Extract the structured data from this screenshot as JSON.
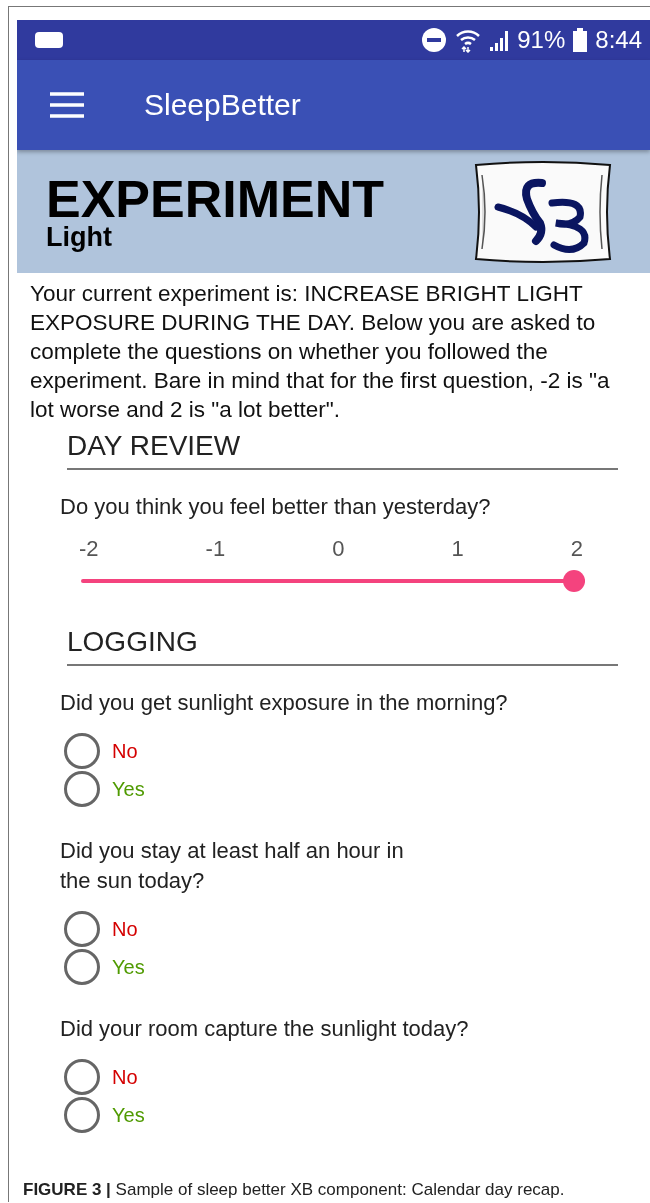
{
  "status_bar": {
    "battery": "91%",
    "time": "8:44"
  },
  "app_bar": {
    "title": "SleepBetter"
  },
  "header": {
    "title": "EXPERIMENT",
    "subtitle": "Light"
  },
  "intro": "Your current experiment is: INCREASE BRIGHT LIGHT EXPOSURE DURING THE DAY. Below you are asked to complete the questions on whether you followed the experiment. Bare in mind that for the first question, -2 is \"a lot worse and 2 is \"a lot better\".",
  "sections": [
    {
      "heading": "DAY REVIEW",
      "items": [
        {
          "kind": "slider",
          "question": "Do you think you feel better than yesterday?",
          "ticks": [
            "-2",
            "-1",
            "0",
            "1",
            "2"
          ],
          "level": 1
        }
      ]
    },
    {
      "heading": "LOGGING",
      "items": [
        {
          "kind": "radio",
          "question": "Did you get sunlight exposure in the morning?",
          "options": [
            {
              "label": "No",
              "selected": false,
              "color": "#d40000"
            },
            {
              "label": "Yes",
              "selected": false,
              "color": "#4f9a00"
            }
          ]
        },
        {
          "kind": "radio",
          "question": "Did you stay at least half an hour in\nthe sun today?",
          "options": [
            {
              "label": "No",
              "selected": false,
              "color": "#d40000"
            },
            {
              "label": "Yes",
              "selected": false,
              "color": "#4f9a00"
            }
          ]
        },
        {
          "kind": "radio",
          "question": "Did your room capture the sunlight today?",
          "options": [
            {
              "label": "No",
              "selected": false,
              "color": "#d40000"
            },
            {
              "label": "Yes",
              "selected": false,
              "color": "#4f9a00"
            }
          ]
        }
      ]
    }
  ],
  "caption": "**FIGURE 3 |** Sample of sleep better XB component: Calendar day recap."
}
